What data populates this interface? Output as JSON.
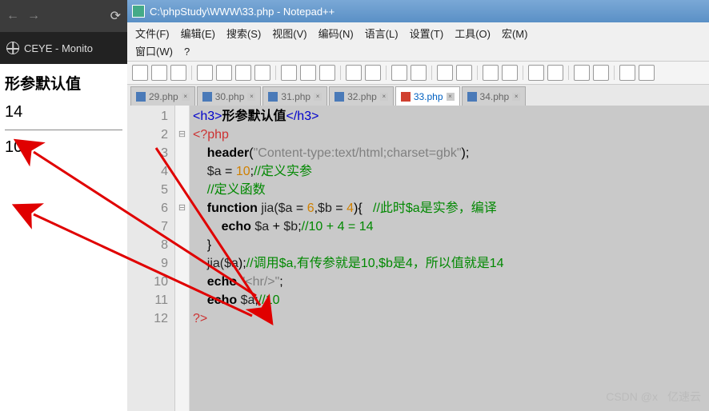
{
  "browser": {
    "url_text": "CEYE - Monito",
    "heading": "形参默认值",
    "result1": "14",
    "result2": "10"
  },
  "notepad": {
    "title": "C:\\phpStudy\\WWW\\33.php - Notepad++",
    "menu_row1": [
      "文件(F)",
      "编辑(E)",
      "搜索(S)",
      "视图(V)",
      "编码(N)",
      "语言(L)",
      "设置(T)",
      "工具(O)",
      "宏(M)"
    ],
    "menu_row2": [
      "窗口(W)",
      "?"
    ],
    "tabs": [
      {
        "label": "29.php",
        "active": false
      },
      {
        "label": "30.php",
        "active": false
      },
      {
        "label": "31.php",
        "active": false
      },
      {
        "label": "32.php",
        "active": false
      },
      {
        "label": "33.php",
        "active": true
      },
      {
        "label": "34.php",
        "active": false
      }
    ],
    "code": {
      "l1_tag1": "<h3>",
      "l1_txt": "形参默认值",
      "l1_tag2": "</h3>",
      "l2": "<?php",
      "l3_kw": "header",
      "l3_paren1": "(",
      "l3_str": "\"Content-type:text/html;charset=gbk\"",
      "l3_paren2": ");",
      "l4_var": "$a",
      "l4_eq": " = ",
      "l4_num": "10",
      "l4_semi": ";",
      "l4_com": "//定义实参",
      "l5_com": "//定义函数",
      "l6_kw": "function",
      "l6_name": " jia(",
      "l6_v1": "$a",
      "l6_e1": " = ",
      "l6_n1": "6",
      "l6_c": ",",
      "l6_v2": "$b",
      "l6_e2": " = ",
      "l6_n2": "4",
      "l6_p": "){   ",
      "l6_com": "//此时$a是实参，编译",
      "l7_kw": "echo",
      "l7_v1": " $a",
      "l7_op": " + ",
      "l7_v2": "$b",
      "l7_s": ";",
      "l7_com": "//10 + 4 = 14",
      "l8": "}",
      "l9_call": "jia(",
      "l9_var": "$a",
      "l9_p": ");",
      "l9_com": "//调用$a,有传参就是10,$b是4，所以值就是14",
      "l10_kw": "echo",
      "l10_sp": " ",
      "l10_str": "\"<hr/>\"",
      "l10_s": ";",
      "l11_kw": "echo",
      "l11_v": " $a",
      "l11_s": ";",
      "l11_com": "//10",
      "l12": "?>"
    }
  },
  "watermark": {
    "text1": "CSDN @x",
    "text2": "亿速云"
  }
}
